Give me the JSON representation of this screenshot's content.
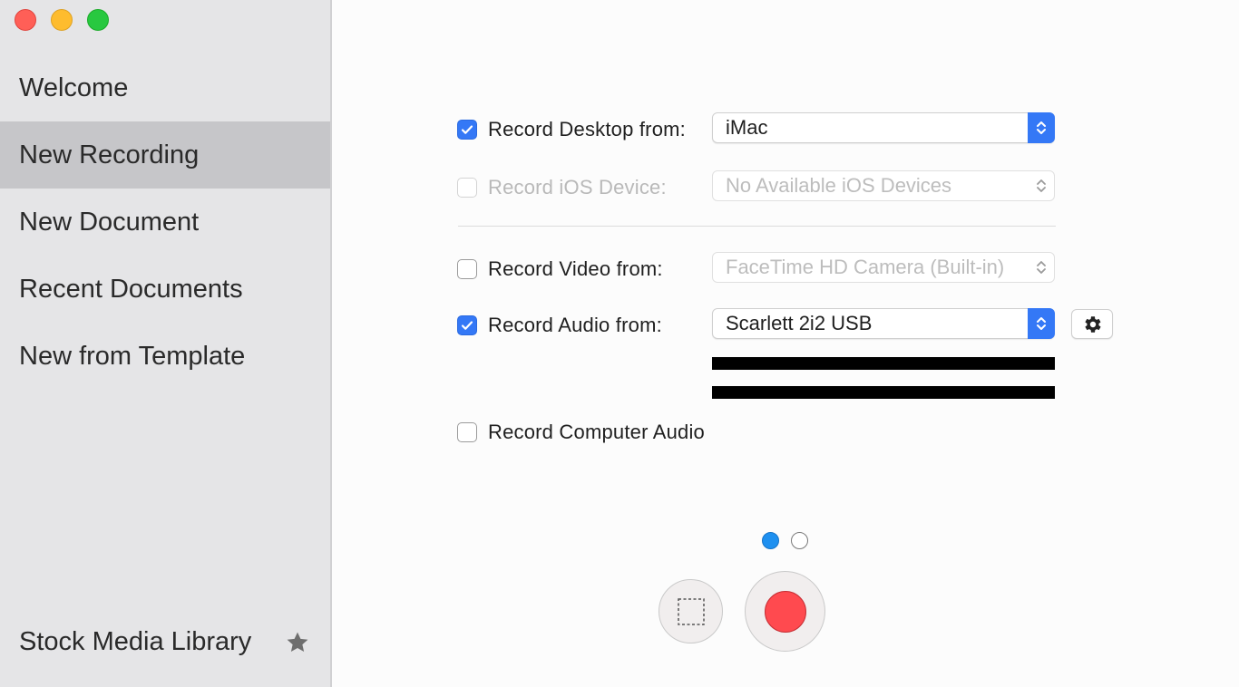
{
  "window": {
    "controls": [
      "close",
      "minimize",
      "zoom"
    ]
  },
  "sidebar": {
    "items": [
      {
        "label": "Welcome",
        "selected": false
      },
      {
        "label": "New Recording",
        "selected": true
      },
      {
        "label": "New Document",
        "selected": false
      },
      {
        "label": "Recent Documents",
        "selected": false
      },
      {
        "label": "New from Template",
        "selected": false
      }
    ],
    "footer": {
      "label": "Stock Media Library",
      "icon": "star-icon"
    }
  },
  "form": {
    "desktop": {
      "label": "Record Desktop from:",
      "checked": true,
      "value": "iMac"
    },
    "ios": {
      "label": "Record iOS Device:",
      "checked": false,
      "enabled": false,
      "value": "No Available iOS Devices"
    },
    "video": {
      "label": "Record Video from:",
      "checked": false,
      "value": "FaceTime HD Camera (Built-in)"
    },
    "audio": {
      "label": "Record Audio from:",
      "checked": true,
      "value": "Scarlett 2i2 USB",
      "settings_icon": "gear-icon"
    },
    "computer_audio": {
      "label": "Record Computer Audio",
      "checked": false
    }
  },
  "pagination": {
    "current": 1,
    "total": 2
  },
  "colors": {
    "accent": "#3478f6",
    "record": "#ff4a4f",
    "page_active": "#1e90f0"
  }
}
